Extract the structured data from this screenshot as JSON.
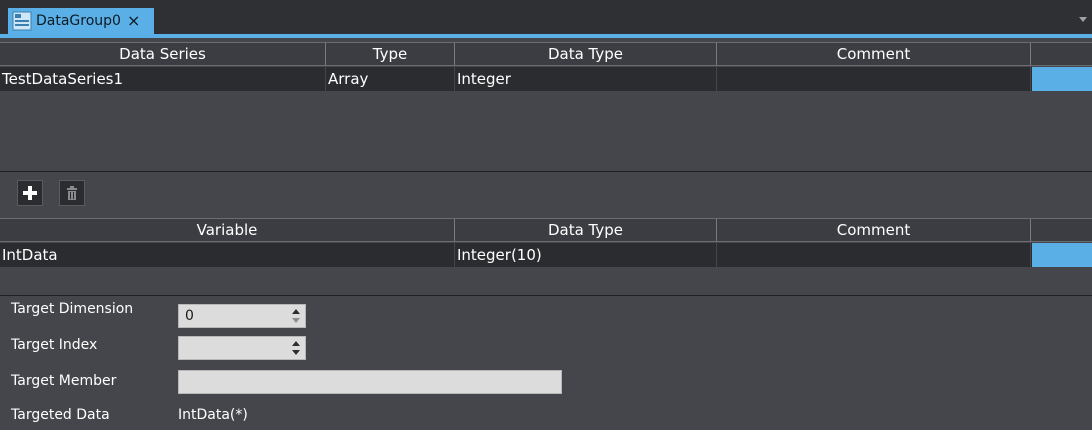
{
  "tab": {
    "title": "DataGroup0",
    "close": "×"
  },
  "series_table": {
    "headers": [
      "Data Series",
      "Type",
      "Data Type",
      "Comment"
    ],
    "rows": [
      {
        "data_series": "TestDataSeries1",
        "type": "Array",
        "data_type": "Integer",
        "comment": ""
      }
    ]
  },
  "toolbar": {
    "add_icon": "plus-icon",
    "delete_icon": "trash-icon"
  },
  "variable_table": {
    "headers": [
      "Variable",
      "Data Type",
      "Comment"
    ],
    "rows": [
      {
        "variable": "IntData",
        "data_type": "Integer(10)",
        "comment": ""
      }
    ]
  },
  "properties": {
    "target_dimension_label": "Target Dimension",
    "target_dimension_value": "0",
    "target_index_label": "Target Index",
    "target_index_value": "",
    "target_member_label": "Target Member",
    "target_member_value": "",
    "targeted_data_label": "Targeted Data",
    "targeted_data_value": "IntData(*)"
  },
  "colors": {
    "accent": "#5ab0e6",
    "panel": "#45464b",
    "row": "#2b2c30"
  }
}
